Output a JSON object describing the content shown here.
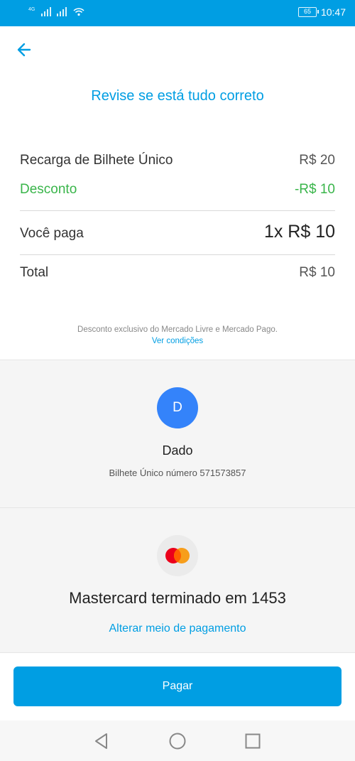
{
  "status_bar": {
    "net_label_1": "4G",
    "time": "10:47",
    "battery": "65"
  },
  "header": {
    "title": "Revise se está tudo correto"
  },
  "summary": {
    "item_label": "Recarga de Bilhete Único",
    "item_value": "R$ 20",
    "discount_label": "Desconto",
    "discount_value": "-R$ 10",
    "you_pay_label": "Você paga",
    "you_pay_value": "1x R$ 10",
    "total_label": "Total",
    "total_value": "R$ 10"
  },
  "disclaimer": {
    "text": "Desconto exclusivo do Mercado Livre e Mercado Pago.",
    "link": "Ver condições"
  },
  "recipient": {
    "initial": "D",
    "name": "Dado",
    "detail": "Bilhete Único número 571573857"
  },
  "payment_method": {
    "text": "Mastercard terminado em 1453",
    "change_link": "Alterar meio de pagamento"
  },
  "pay_button": {
    "label": "Pagar"
  },
  "colors": {
    "accent": "#009ee3",
    "discount": "#39b54a",
    "avatar": "#3483fa"
  }
}
